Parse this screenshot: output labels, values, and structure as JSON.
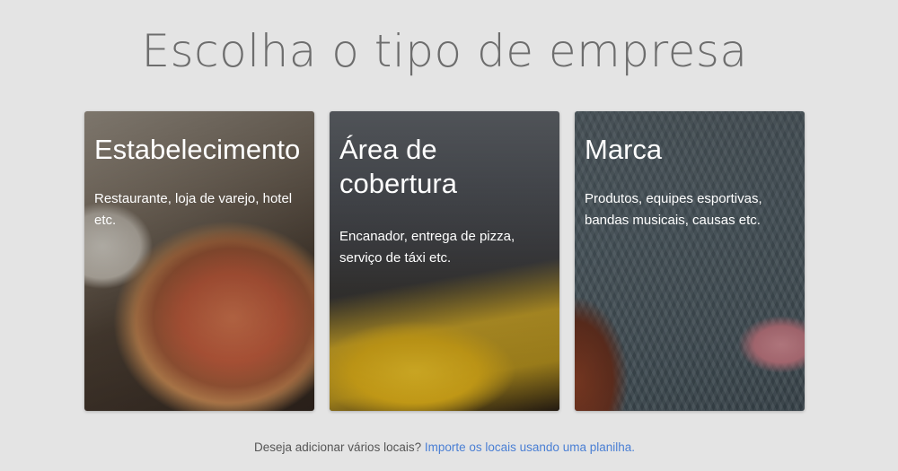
{
  "header": {
    "title": "Escolha o tipo de empresa"
  },
  "cards": [
    {
      "title": "Estabelecimento",
      "description": "Restaurante, loja de varejo, hotel etc."
    },
    {
      "title": "Área de\ncobertura",
      "description": "Encanador, entrega de pizza, serviço de táxi etc."
    },
    {
      "title": "Marca",
      "description": "Produtos, equipes esportivas, bandas musicais, causas etc."
    }
  ],
  "footer": {
    "question": "Deseja adicionar vários locais?",
    "link_label": "Importe os locais usando uma planilha."
  }
}
